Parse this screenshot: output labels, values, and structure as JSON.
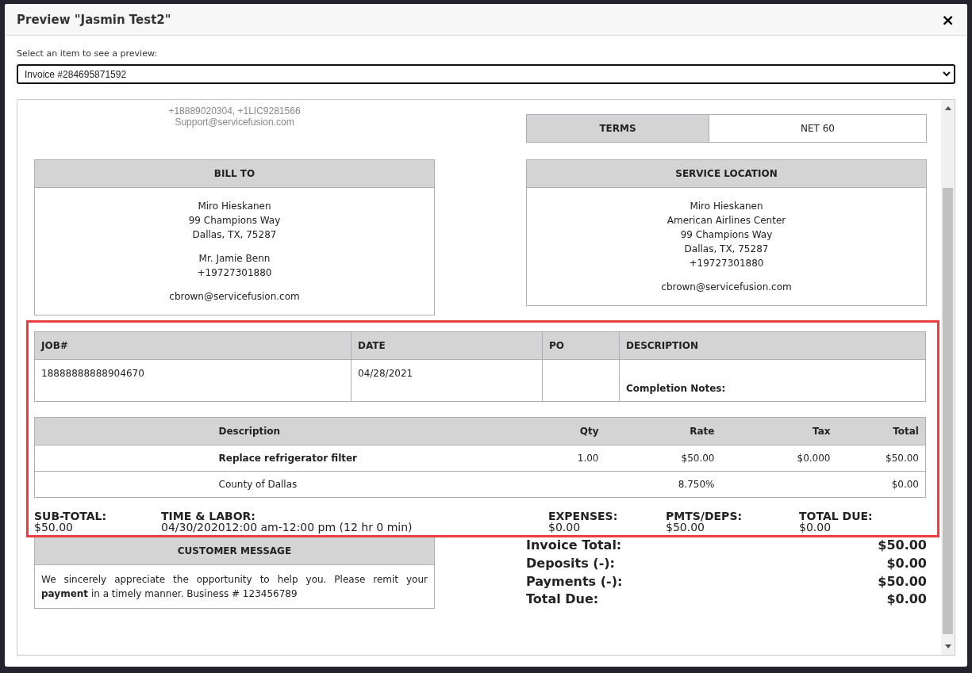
{
  "dialog": {
    "title": "Preview \"Jasmin Test2\"",
    "close": "×"
  },
  "picker": {
    "label": "Select an item to see a preview:",
    "value": "Invoice #284695871592"
  },
  "invoice": {
    "company_lines": [
      "+18889020304, +1LIC9281566",
      "Support@servicefusion.com"
    ],
    "terms": {
      "label": "TERMS",
      "value": "NET 60"
    },
    "bill_to": {
      "title": "BILL TO",
      "groups": [
        [
          "Miro Hieskanen",
          "99 Champions Way",
          "Dallas, TX, 75287"
        ],
        [
          "Mr. Jamie Benn",
          "+19727301880"
        ],
        [
          "cbrown@servicefusion.com"
        ]
      ]
    },
    "service_location": {
      "title": "SERVICE LOCATION",
      "groups": [
        [
          "Miro Hieskanen",
          "American Airlines Center",
          "99 Champions Way",
          "Dallas, TX, 75287",
          "+19727301880"
        ],
        [
          "cbrown@servicefusion.com"
        ]
      ]
    },
    "highlighted": true,
    "job_table": {
      "columns": [
        "JOB#",
        "DATE",
        "PO",
        "DESCRIPTION"
      ],
      "job": "18888888888904670",
      "date": "04/28/2021",
      "notes_label": "Completion Notes:"
    },
    "items": {
      "columns": [
        "Description",
        "Qty",
        "Rate",
        "Tax",
        "Total"
      ],
      "rows": [
        {
          "kind": "item",
          "description": "Replace refrigerator filter",
          "qty": "1.00",
          "rate": "$50.00",
          "tax": "$0.000",
          "total": "$50.00"
        },
        {
          "kind": "tax",
          "description": "County of Dallas",
          "rate": "8.750%",
          "total": "$0.00"
        }
      ]
    },
    "summary": [
      {
        "label": "SUB-TOTAL:",
        "value": "$50.00"
      },
      {
        "label": "TIME & LABOR:",
        "value": "04/30/202012:00 am-12:00 pm (12 hr 0 min)"
      },
      {
        "label": "EXPENSES:",
        "value": "$0.00"
      },
      {
        "label": "PMTS/DEPS:",
        "value": "$50.00"
      },
      {
        "label": "TOTAL DUE:",
        "value": "$0.00"
      }
    ],
    "customer_message": {
      "title": "CUSTOMER MESSAGE",
      "text": "We sincerely appreciate the opportunity to help you. Please remit your **payment** in a timely manner. Business # 123456789"
    },
    "totals": [
      {
        "label": "Invoice Total:",
        "value": "$50.00"
      },
      {
        "label": "Deposits (-):",
        "value": "$0.00"
      },
      {
        "label": "Payments (-):",
        "value": "$50.00"
      },
      {
        "label": "Total Due:",
        "value": "$0.00"
      }
    ]
  }
}
